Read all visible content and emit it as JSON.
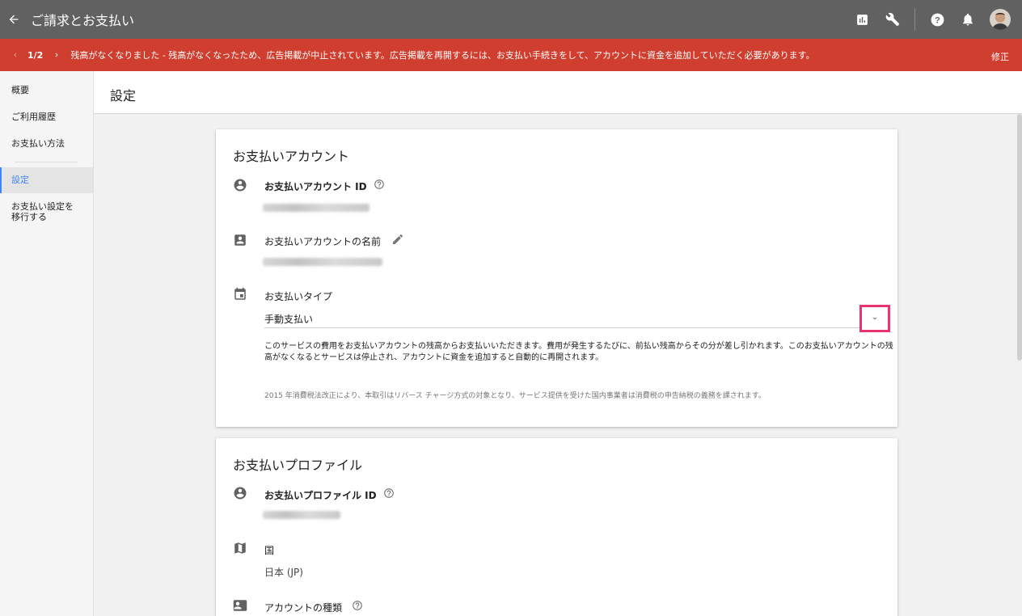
{
  "app": {
    "title": "ご請求とお支払い"
  },
  "top_icons": [
    "reports-icon",
    "tools-icon",
    "help-icon",
    "notifications-icon"
  ],
  "alert": {
    "pager": "1/2",
    "message": "残高がなくなりました - 残高がなくなったため、広告掲載が中止されています。広告掲載を再開するには、お支払い手続きをして、アカウントに資金を追加していただく必要があります。",
    "action": "修正",
    "color": "#cf3e2e"
  },
  "sidebar": {
    "items": [
      {
        "label": "概要"
      },
      {
        "label": "ご利用履歴"
      },
      {
        "label": "お支払い方法"
      },
      {
        "label": "設定"
      },
      {
        "label": "お支払い設定を移行する"
      }
    ],
    "active_color": "#4285f4"
  },
  "page": {
    "title": "設定"
  },
  "payment_account": {
    "title": "お支払いアカウント",
    "id_label": "お支払いアカウント ID",
    "name_label": "お支払いアカウントの名前",
    "type_label": "お支払いタイプ",
    "type_value": "手動支払い",
    "description": "このサービスの費用をお支払いアカウントの残高からお支払いいただきます。費用が発生するたびに、前払い残高からその分が差し引かれます。このお支払いアカウントの残高がなくなるとサービスは停止され、アカウントに資金を追加すると自動的に再開されます。",
    "tax_note": "2015 年消費税法改正により、本取引はリバース チャージ方式の対象となり、サービス提供を受けた国内事業者は消費税の申告納税の義務を課されます。",
    "highlight_color": "#e9356f"
  },
  "payment_profile": {
    "title": "お支払いプロファイル",
    "id_label": "お支払いプロファイル ID",
    "country_label": "国",
    "country_value": "日本 (JP)",
    "account_type_label": "アカウントの種類"
  }
}
